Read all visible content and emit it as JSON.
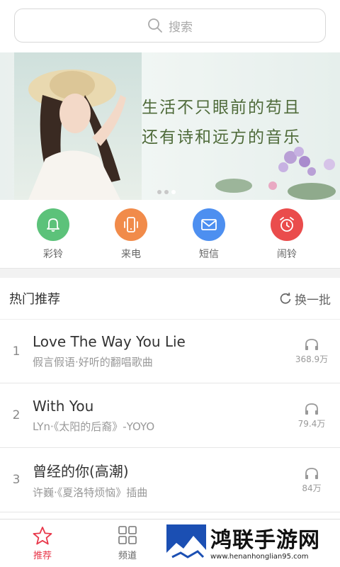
{
  "search": {
    "placeholder": "搜索"
  },
  "banner": {
    "line1": "生活不只眼前的苟且",
    "line2": "还有诗和远方的音乐"
  },
  "shortcuts": [
    {
      "label": "彩铃",
      "color": "#5cc27a",
      "icon": "bell-icon"
    },
    {
      "label": "来电",
      "color": "#f18b4a",
      "icon": "phone-vibrate-icon"
    },
    {
      "label": "短信",
      "color": "#4d8ff0",
      "icon": "envelope-icon"
    },
    {
      "label": "闹铃",
      "color": "#ea4c4c",
      "icon": "alarm-clock-icon"
    }
  ],
  "hot": {
    "title": "热门推荐",
    "refresh_label": "换一批"
  },
  "songs": [
    {
      "rank": "1",
      "title": "Love The Way You Lie",
      "sub": "假言假语·好听的翻唱歌曲",
      "plays": "368.9万"
    },
    {
      "rank": "2",
      "title": "With You",
      "sub": "LYn·《太阳的后裔》-YOYO",
      "plays": "79.4万"
    },
    {
      "rank": "3",
      "title": "曾经的你(高潮)",
      "sub": "许巍·《夏洛特烦恼》插曲",
      "plays": "84万"
    }
  ],
  "tabs": [
    {
      "label": "推荐",
      "icon": "star-icon",
      "active": true
    },
    {
      "label": "频道",
      "icon": "grid-icon",
      "active": false
    }
  ],
  "watermark": {
    "name": "鸿联手游网",
    "url": "www.henanhonglian95.com"
  },
  "colors": {
    "accent": "#e8374a"
  }
}
